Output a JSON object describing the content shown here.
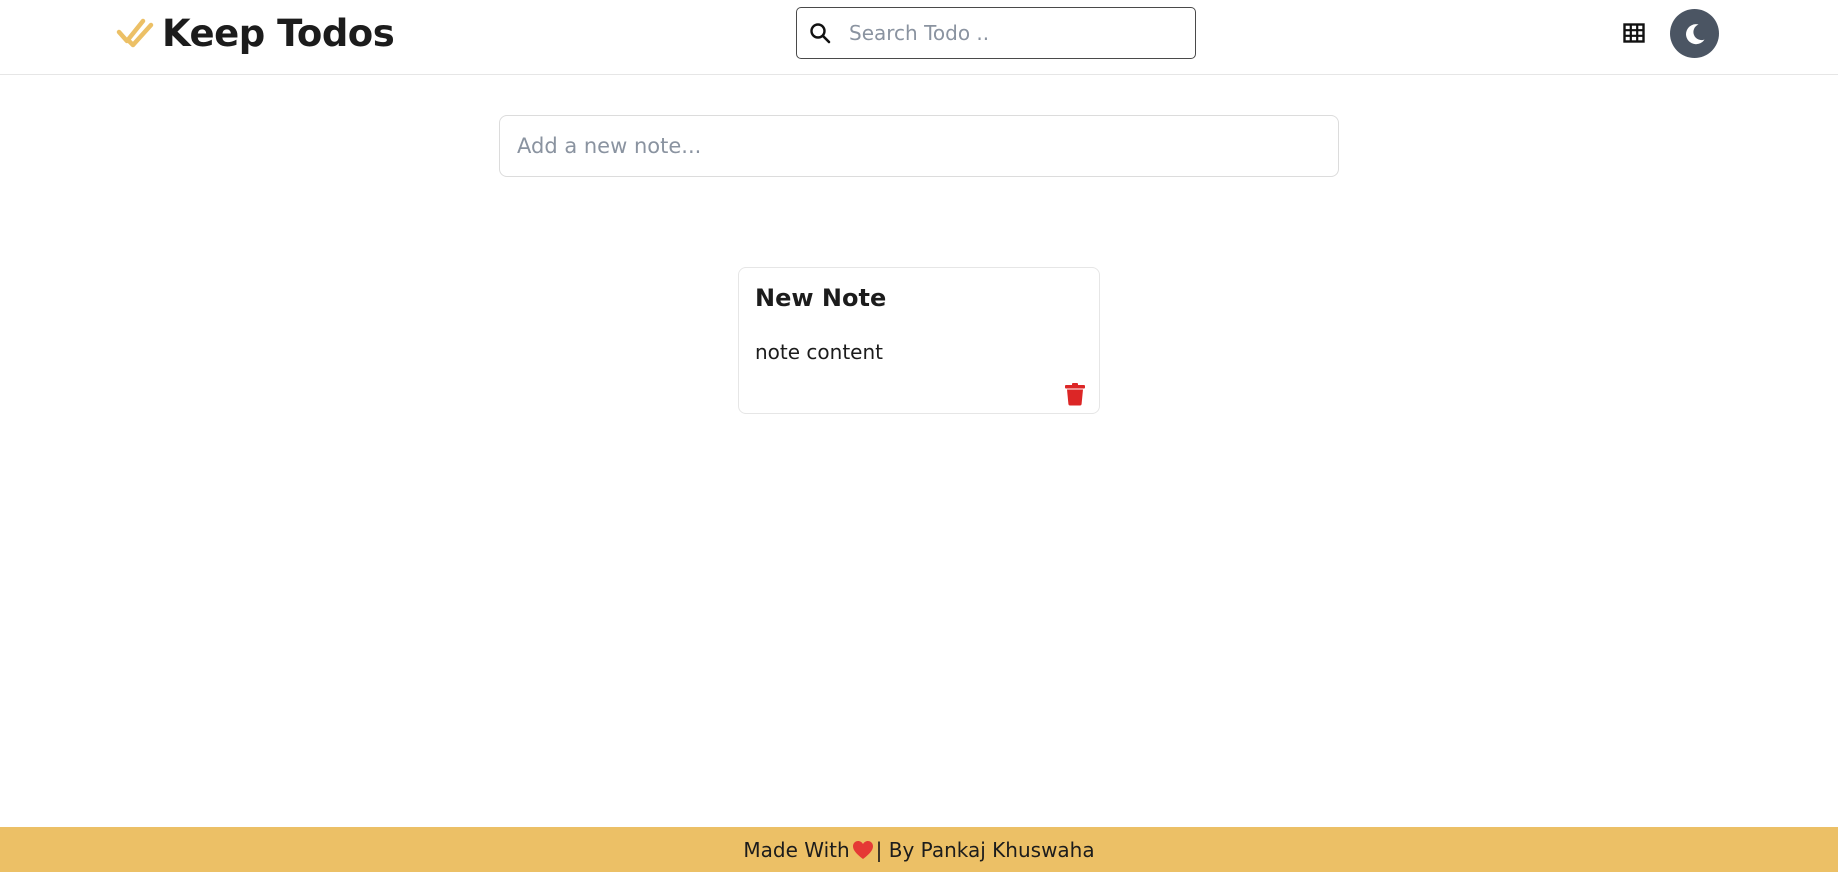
{
  "header": {
    "title": "Keep Todos",
    "brand_icon": "double-check-icon",
    "brand_color": "#ecc066",
    "search": {
      "placeholder": "Search Todo .."
    },
    "grid_icon": "grid-view-icon",
    "theme_icon": "moon-icon",
    "theme_button_color": "#4b5563"
  },
  "main": {
    "new_note_placeholder": "Add a new note...",
    "notes": [
      {
        "title": "New Note",
        "content": "note content",
        "delete_icon": "trash-icon",
        "delete_color": "#dc2626"
      }
    ]
  },
  "footer": {
    "made_with": "Made With",
    "heart_icon": "heart-icon",
    "heart_color": "#e53935",
    "by_text": "| By Pankaj Khuswaha",
    "background": "#ecc066"
  }
}
